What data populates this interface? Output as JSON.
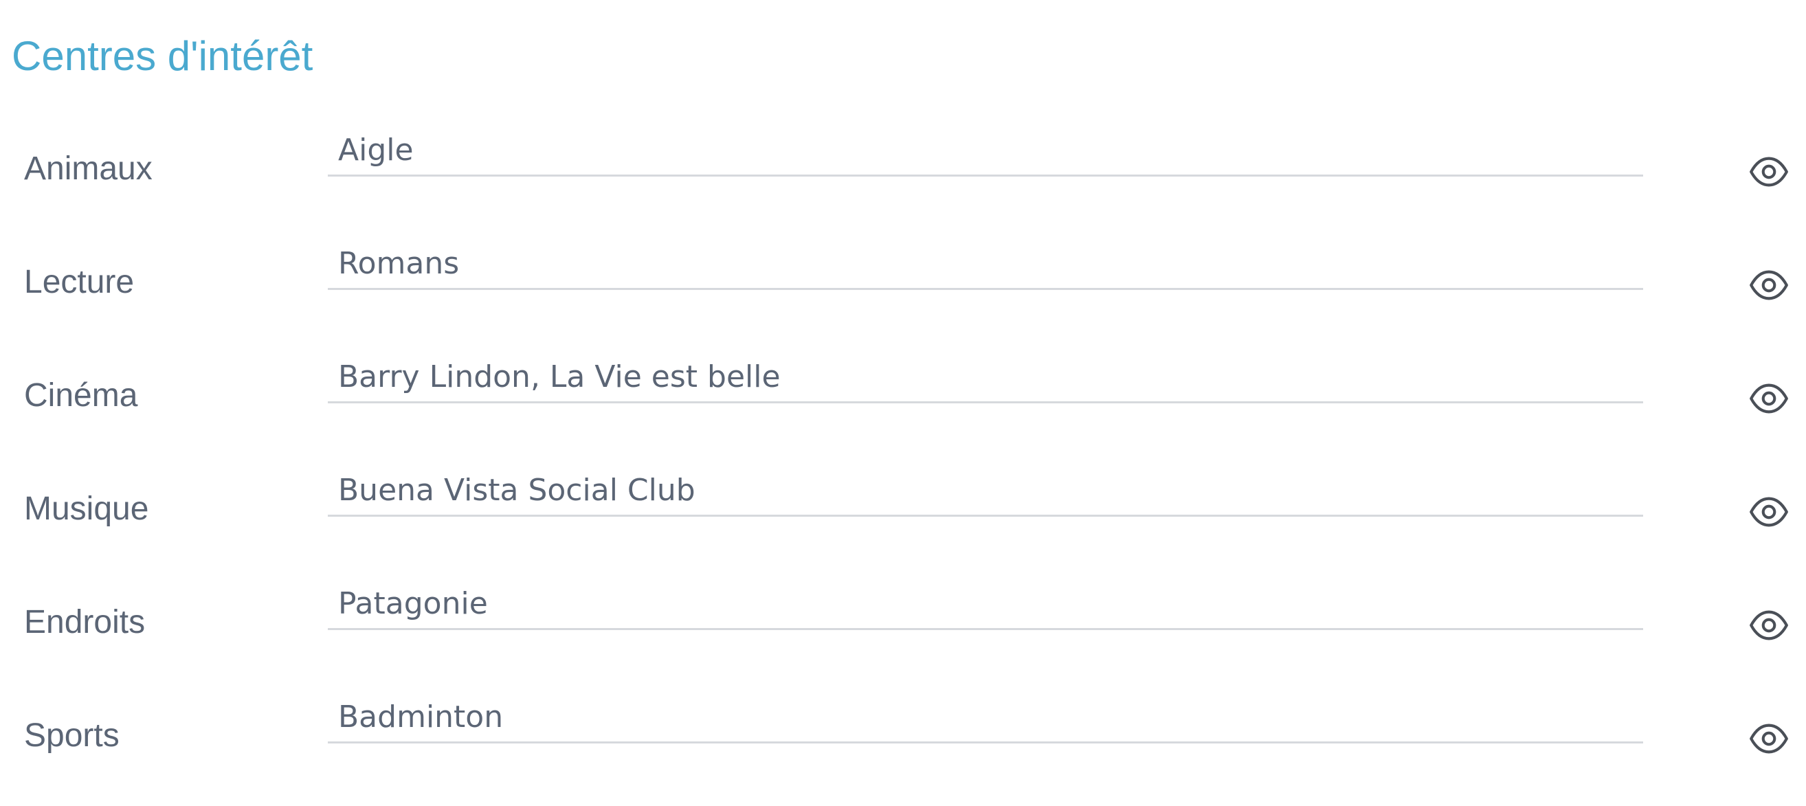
{
  "section": {
    "title": "Centres d'intérêt"
  },
  "interests": [
    {
      "label": "Animaux",
      "value": "Aigle",
      "visibility_icon": "eye-icon"
    },
    {
      "label": "Lecture",
      "value": "Romans",
      "visibility_icon": "eye-icon"
    },
    {
      "label": "Cinéma",
      "value": "Barry Lindon, La Vie est belle",
      "visibility_icon": "eye-icon"
    },
    {
      "label": "Musique",
      "value": "Buena Vista Social Club",
      "visibility_icon": "eye-icon"
    },
    {
      "label": "Endroits",
      "value": "Patagonie",
      "visibility_icon": "eye-icon"
    },
    {
      "label": "Sports",
      "value": "Badminton",
      "visibility_icon": "eye-icon"
    }
  ],
  "colors": {
    "title": "#4aa9cf",
    "text": "#5b6575",
    "underline": "#d6d9dd",
    "icon": "#4a4f57"
  }
}
